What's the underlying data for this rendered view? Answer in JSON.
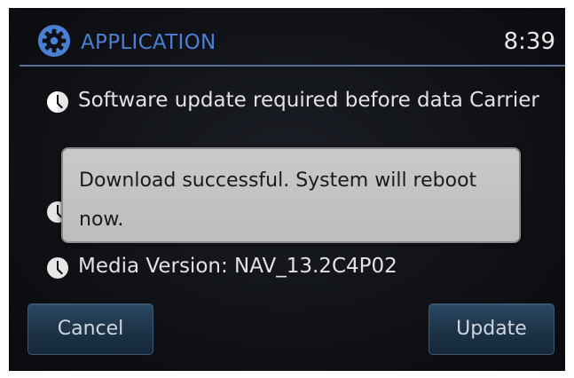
{
  "header": {
    "title": "APPLICATION",
    "time": "8:39",
    "icon": "gear-icon"
  },
  "info_rows": [
    {
      "icon": "info-icon",
      "text": "Software update required before data Carrier"
    },
    {
      "icon": "info-icon",
      "text": ""
    },
    {
      "icon": "info-icon",
      "text": "Media Version: NAV_13.2C4P02"
    }
  ],
  "popup": {
    "message": "Download successful. System will reboot now."
  },
  "buttons": {
    "cancel_label": "Cancel",
    "update_label": "Update"
  },
  "colors": {
    "title_accent": "#4a7fd4",
    "popup_bg": "#c4c4c4",
    "button_bg": "#1c3247"
  }
}
